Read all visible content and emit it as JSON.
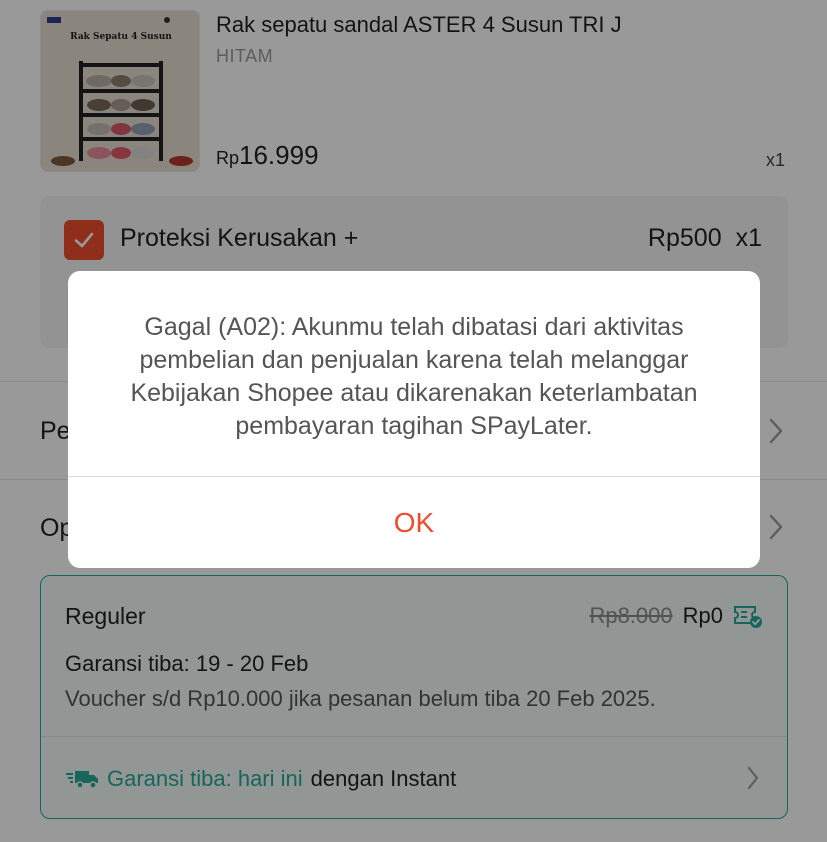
{
  "product": {
    "image_title": "Rak Sepatu 4 Susun",
    "name": "Rak sepatu sandal ASTER 4 Susun TRI J",
    "variant": "HITAM",
    "price_currency": "Rp",
    "price_amount": "16.999",
    "quantity": "x1"
  },
  "protection": {
    "title": "Proteksi Kerusakan +",
    "price": "Rp500",
    "quantity": "x1",
    "checked": true
  },
  "rows": {
    "row1_label": "Pe",
    "row2_label": "Op"
  },
  "shipping": {
    "name": "Reguler",
    "original_price": "Rp8.000",
    "price": "Rp0",
    "guarantee": "Garansi tiba: 19 - 20 Feb",
    "voucher": "Voucher s/d  Rp10.000 jika pesanan belum tiba 20 Feb 2025.",
    "instant_highlight": "Garansi tiba: hari ini",
    "instant_rest": "dengan Instant"
  },
  "dialog": {
    "message": "Gagal (A02): Akunmu telah dibatasi dari aktivitas pembelian dan penjualan karena telah melanggar Kebijakan Shopee atau dikarenakan keterlambatan pembayaran tagihan SPayLater.",
    "ok_label": "OK"
  },
  "colors": {
    "accent": "#ee4d2d",
    "teal": "#26aa99",
    "overlay": "rgba(0,0,0,0.4)"
  }
}
